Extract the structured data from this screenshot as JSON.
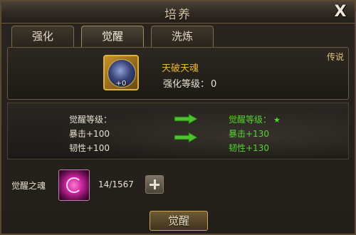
{
  "window": {
    "title": "培养",
    "close_label": "X"
  },
  "tabs": [
    {
      "label": "强化",
      "active": false
    },
    {
      "label": "觉醒",
      "active": true
    },
    {
      "label": "洗炼",
      "active": false
    }
  ],
  "item": {
    "rarity": "传说",
    "name": "天破天魂",
    "plus": "+0",
    "enhance_label": "强化等级：",
    "enhance_value": "0",
    "icon": "dragon-orb-icon",
    "name_color": "#f0b432"
  },
  "stats": {
    "current": {
      "level_label": "觉醒等级：",
      "crit": "暴击+100",
      "toughness": "韧性+100"
    },
    "next": {
      "level_label": "觉醒等级：",
      "star": "★",
      "crit": "暴击+130",
      "toughness": "韧性+130"
    },
    "upgrade_color": "#56d236"
  },
  "soul": {
    "label": "觉醒之魂",
    "count": "14/1567",
    "icon": "awakening-soul-icon"
  },
  "actions": {
    "awaken_label": "觉醒"
  }
}
